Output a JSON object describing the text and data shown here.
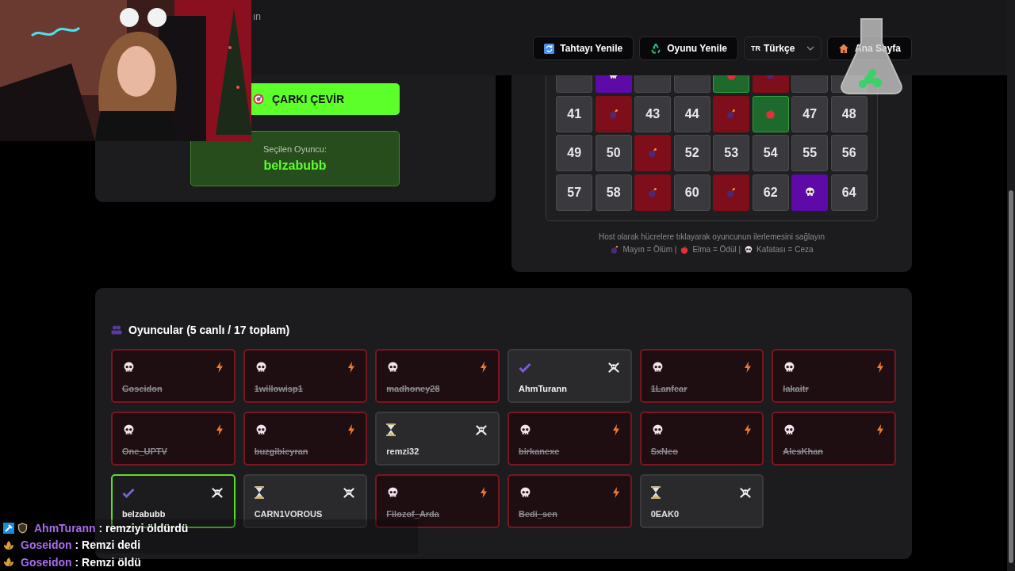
{
  "header": {
    "title_fragment": "ın",
    "buttons": [
      {
        "kind": "refresh",
        "label": "Tahtayı Yenile"
      },
      {
        "kind": "recycle",
        "label": "Oyunu Yenile"
      },
      {
        "kind": "language",
        "flag": "TR",
        "label": "Türkçe"
      },
      {
        "kind": "home",
        "label": "Ana Sayfa"
      }
    ]
  },
  "wheel": {
    "spin_button": "ÇARKI ÇEVİR",
    "selected_label": "Seçilen Oyuncu:",
    "selected_player": "belzabubb"
  },
  "board": {
    "cells": [
      {
        "kind": "number"
      },
      {
        "kind": "skull"
      },
      {
        "kind": "number"
      },
      {
        "kind": "number"
      },
      {
        "kind": "apple"
      },
      {
        "kind": "bomb"
      },
      {
        "kind": "number"
      },
      {
        "kind": "number"
      },
      {
        "kind": "number",
        "label": "41"
      },
      {
        "kind": "bomb"
      },
      {
        "kind": "number",
        "label": "43"
      },
      {
        "kind": "number",
        "label": "44"
      },
      {
        "kind": "bomb"
      },
      {
        "kind": "apple"
      },
      {
        "kind": "number",
        "label": "47"
      },
      {
        "kind": "number",
        "label": "48"
      },
      {
        "kind": "number",
        "label": "49"
      },
      {
        "kind": "number",
        "label": "50"
      },
      {
        "kind": "bomb"
      },
      {
        "kind": "number",
        "label": "52"
      },
      {
        "kind": "number",
        "label": "53"
      },
      {
        "kind": "number",
        "label": "54"
      },
      {
        "kind": "number",
        "label": "55"
      },
      {
        "kind": "number",
        "label": "56"
      },
      {
        "kind": "number",
        "label": "57"
      },
      {
        "kind": "number",
        "label": "58"
      },
      {
        "kind": "bomb"
      },
      {
        "kind": "number",
        "label": "60"
      },
      {
        "kind": "bomb"
      },
      {
        "kind": "number",
        "label": "62"
      },
      {
        "kind": "skull"
      },
      {
        "kind": "number",
        "label": "64"
      }
    ],
    "hint": "Host olarak hücrelere tıklayarak oyuncunun ilerlemesini sağlayın",
    "legend": [
      {
        "kind": "bomb",
        "text": "Mayın = Ölüm |"
      },
      {
        "kind": "apple",
        "text": "Elma = Ödül |"
      },
      {
        "kind": "skull",
        "text": "Kafatası = Ceza"
      }
    ]
  },
  "players": {
    "title": "Oyuncular (5 canlı / 17 toplam)",
    "list": [
      {
        "name": "Goseidon",
        "kind": "dead",
        "selected": false
      },
      {
        "name": "1willowisp1",
        "kind": "dead",
        "selected": false
      },
      {
        "name": "madhoney28",
        "kind": "dead",
        "selected": false
      },
      {
        "name": "AhmTurann",
        "kind": "safe",
        "selected": false
      },
      {
        "name": "1Lanfear",
        "kind": "dead",
        "selected": false
      },
      {
        "name": "lakaitr",
        "kind": "dead",
        "selected": false
      },
      {
        "name": "One_UPTV",
        "kind": "dead",
        "selected": false
      },
      {
        "name": "buzgibieyran",
        "kind": "dead",
        "selected": false
      },
      {
        "name": "remzi32",
        "kind": "waiting",
        "selected": false
      },
      {
        "name": "birkanexe",
        "kind": "dead",
        "selected": false
      },
      {
        "name": "SxNeo",
        "kind": "dead",
        "selected": false
      },
      {
        "name": "AlesKhan",
        "kind": "dead",
        "selected": false
      },
      {
        "name": "belzabubb",
        "kind": "safe",
        "selected": true
      },
      {
        "name": "CARN1VOROUS",
        "kind": "waiting",
        "selected": false
      },
      {
        "name": "Filozof_Arda",
        "kind": "dead",
        "selected": false
      },
      {
        "name": "Bedi_sen",
        "kind": "dead",
        "selected": false
      },
      {
        "name": "0EAK0",
        "kind": "waiting",
        "selected": false
      }
    ]
  },
  "chat": [
    {
      "badges": [
        {
          "kind": "mod"
        },
        {
          "kind": "shield"
        }
      ],
      "user": "AhmTurann",
      "message": ": remziyi öldürdü"
    },
    {
      "badges": [
        {
          "kind": "leaf"
        }
      ],
      "user": "Goseidon",
      "message": ": Remzi dedi"
    },
    {
      "badges": [
        {
          "kind": "leaf"
        }
      ],
      "user": "Goseidon",
      "message": ": Remzi öldü"
    }
  ]
}
